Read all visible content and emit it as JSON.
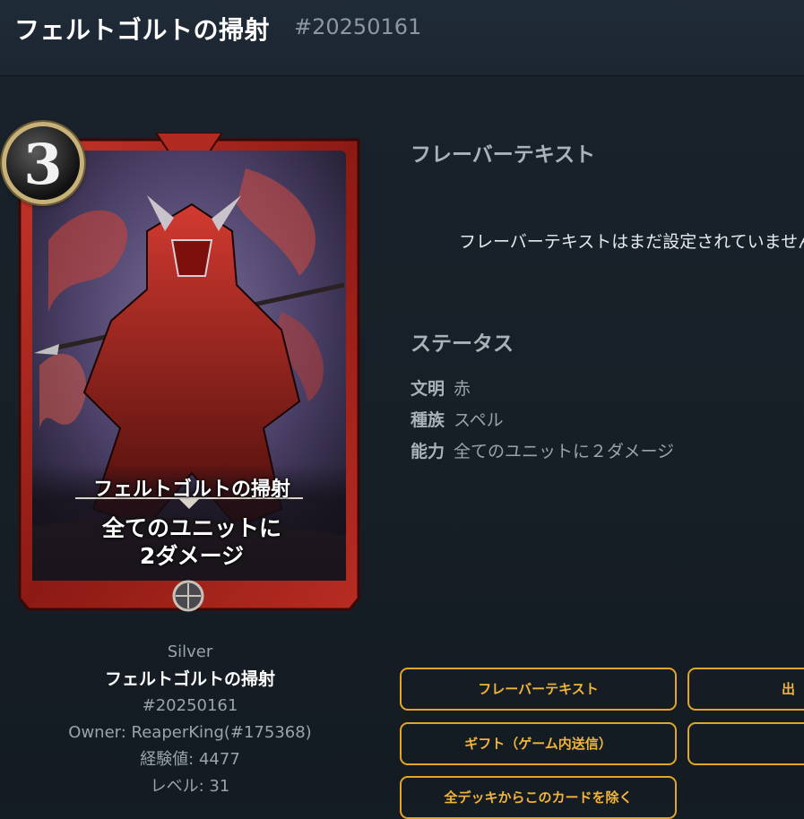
{
  "header": {
    "title": "フェルトゴルトの掃射",
    "card_id": "#20250161"
  },
  "card": {
    "cost": "3",
    "name": "フェルトゴルトの掃射",
    "text_line1": "全てのユニットに",
    "text_line2": "2ダメージ",
    "frame_color": "#a8231b"
  },
  "info": {
    "rarity": "Silver",
    "name": "フェルトゴルトの掃射",
    "id": "#20250161",
    "owner": "Owner: ReaperKing(#175368)",
    "exp": "経験値: 4477",
    "level": "レベル: 31"
  },
  "flavor": {
    "title": "フレーバーテキスト",
    "empty_text": "フレーバーテキストはまだ設定されていません"
  },
  "status": {
    "title": "ステータス",
    "rows": [
      {
        "key": "文明",
        "value": "赤"
      },
      {
        "key": "種族",
        "value": "スペル"
      },
      {
        "key": "能力",
        "value": "全てのユニットに２ダメージ"
      }
    ]
  },
  "buttons": {
    "flavor": "フレーバーテキスト",
    "listing": "出",
    "gift": "ギフト（ゲーム内送信）",
    "empty": "",
    "remove_from_decks": "全デッキからこのカードを除く"
  },
  "colors": {
    "accent": "#e2a42a",
    "background": "#141c24"
  }
}
